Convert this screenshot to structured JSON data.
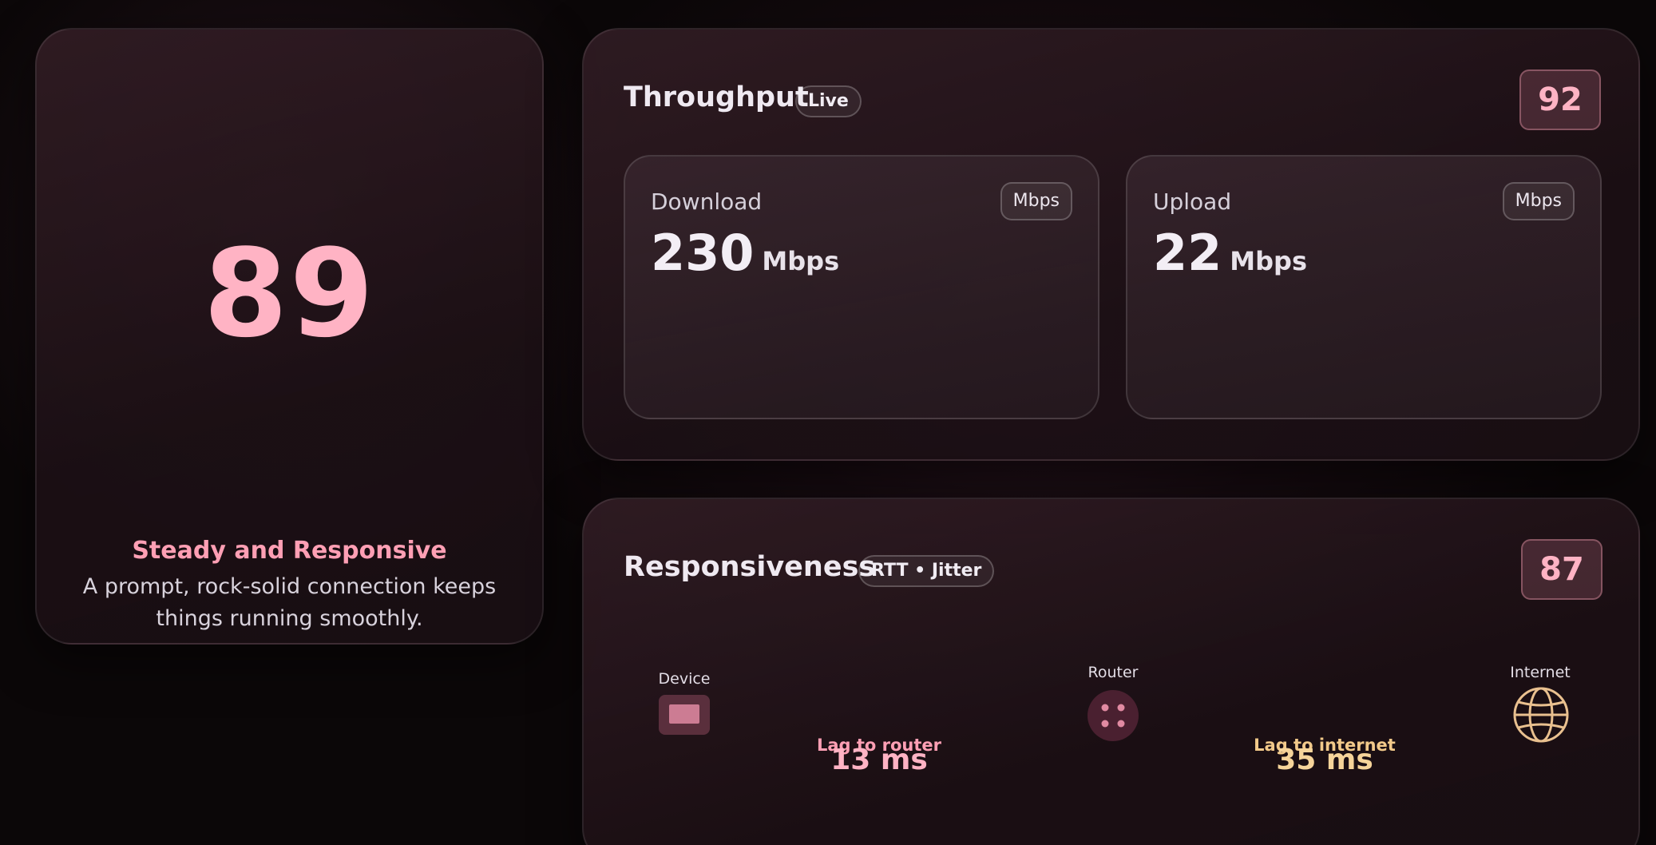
{
  "score": {
    "value": "89",
    "headline": "Steady and Responsive",
    "description": "A prompt, rock-solid connection keeps things running smoothly."
  },
  "throughput": {
    "title": "Throughput",
    "tag": "Live",
    "score": "92",
    "download": {
      "label": "Download",
      "unit_pill": "Mbps",
      "value": "230",
      "unit": "Mbps"
    },
    "upload": {
      "label": "Upload",
      "unit_pill": "Mbps",
      "value": "22",
      "unit": "Mbps"
    }
  },
  "responsiveness": {
    "title": "Responsiveness",
    "tag": "RTT • Jitter",
    "score": "87",
    "nodes": {
      "device": "Device",
      "router": "Router",
      "internet": "Internet"
    },
    "router_lag": {
      "label": "Lag to router",
      "value": "13 ms"
    },
    "internet_lag": {
      "label": "Lag to internet",
      "value": "35 ms"
    }
  },
  "colors": {
    "accent_pink": "#ffb3c4",
    "accent_gold": "#f2c98a",
    "background": "#0b0708"
  },
  "icons": [
    "device-icon",
    "router-icon",
    "globe-icon"
  ]
}
